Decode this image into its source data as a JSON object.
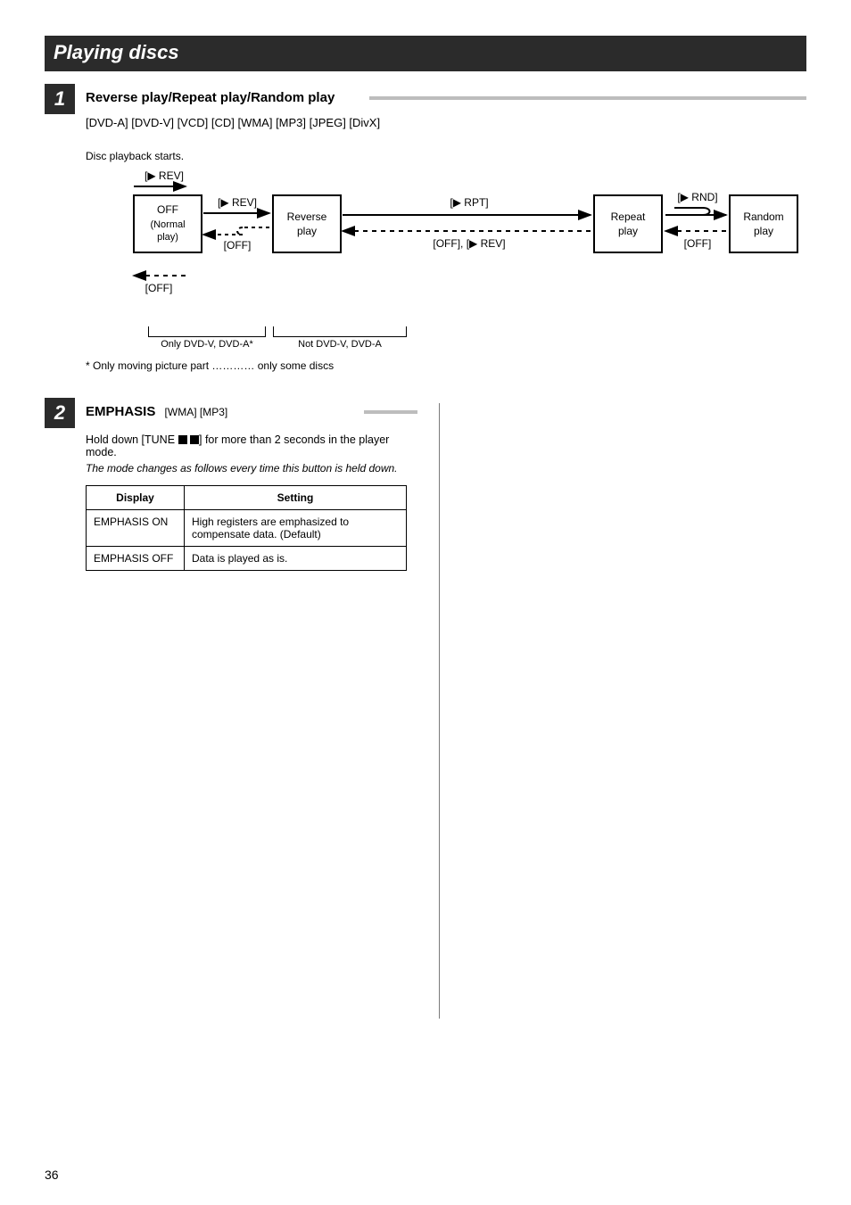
{
  "header": "Playing discs",
  "section1": {
    "number": "1",
    "title": "Reverse play/Repeat play/Random play",
    "subtitle": "[DVD-A] [DVD-V] [VCD] [CD] [WMA] [MP3] [JPEG] [DivX]",
    "diagram": {
      "offLabel": "Disc playback starts.",
      "box1_l1": "OFF",
      "box1_l2": "(Normal",
      "box1_l3": "play)",
      "box1_top_arrow": "[▶ REV]",
      "box1_bottom_arrow": "[OFF]",
      "box2_l1": "Reverse",
      "box2_l2": "play",
      "between12_top": "[▶ REV]",
      "between12_bot": "[OFF]",
      "box3_l1": "Repeat",
      "box3_l2": "play",
      "between23_top": "[▶ RPT]",
      "between23_bot": "[OFF], [▶ REV]",
      "box4_l1": "Random",
      "box4_l2": "play",
      "between34_top": "[▶ RND]",
      "between34_bot": "[OFF]",
      "brk1": "Only DVD-V, DVD-A*",
      "brk2": "Not DVD-V, DVD-A",
      "footnotes": "* Only moving picture part    ………… only some discs"
    }
  },
  "section2": {
    "number": "2",
    "title": "EMPHASIS",
    "type_line": "[WMA] [MP3]",
    "intro1": "Hold down [TUNE ",
    "intro1_tail": "] for more than 2 seconds in the player mode.",
    "intro2": "The mode changes as follows every time this button is held down.",
    "table": {
      "head_c1": "Display",
      "head_c2": "Setting",
      "row1_c1": "EMPHASIS ON",
      "row1_c2": "High registers are emphasized to compensate data. (Default)",
      "row2_c1": "EMPHASIS OFF",
      "row2_c2": "Data is played as is."
    }
  },
  "page": "36"
}
